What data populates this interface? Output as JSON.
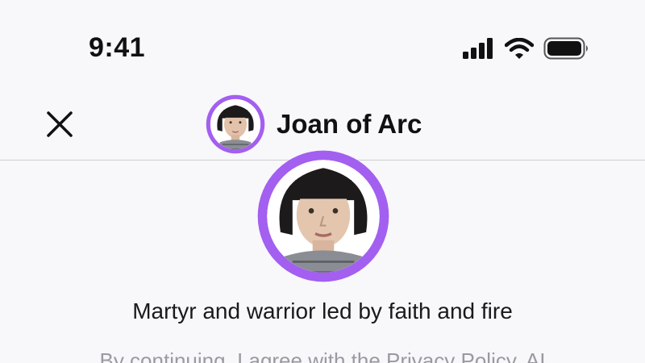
{
  "status_bar": {
    "time": "9:41",
    "icons": [
      "cellular-signal-icon",
      "wifi-icon",
      "battery-icon"
    ]
  },
  "nav": {
    "close_icon": "close-icon",
    "title": "Joan of Arc"
  },
  "profile": {
    "tagline": "Martyr and warrior led by faith and fire",
    "disclaimer": "By continuing, I agree with the Privacy Policy, AI"
  },
  "colors": {
    "accent": "#a35ff0",
    "background": "#f8f7fa",
    "divider": "#cfcfd3",
    "muted_text": "#9a9aa0"
  }
}
